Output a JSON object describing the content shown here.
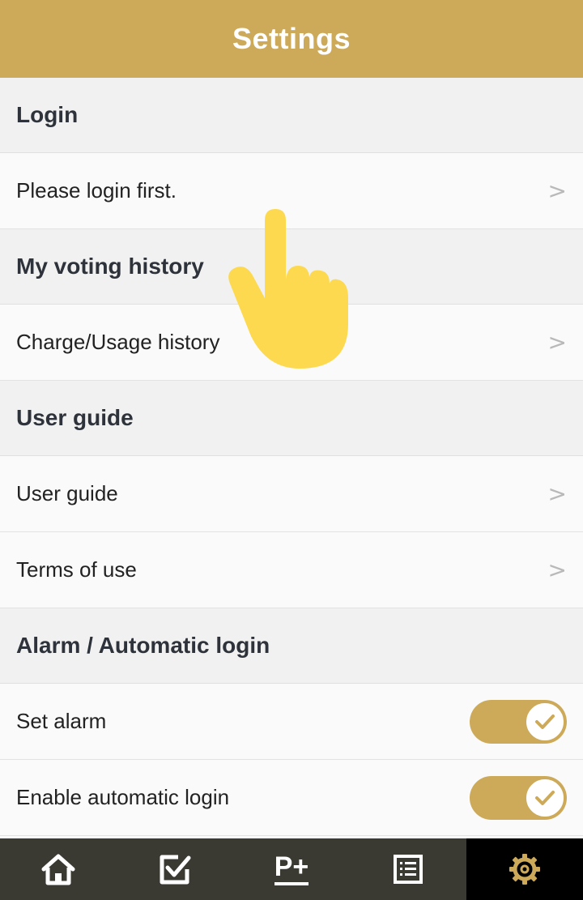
{
  "header": {
    "title": "Settings"
  },
  "sections": {
    "login": {
      "title": "Login",
      "row_label": "Please login first."
    },
    "voting": {
      "title": "My voting history",
      "row_label": "Charge/Usage history"
    },
    "guide": {
      "title": "User guide",
      "rows": [
        "User guide",
        "Terms of use"
      ]
    },
    "alarm": {
      "title": "Alarm / Automatic login",
      "rows": [
        "Set alarm",
        "Enable automatic login"
      ]
    }
  },
  "chevron": ">",
  "toggles": {
    "set_alarm": true,
    "automatic_login": true
  },
  "bottom_nav": {
    "items": [
      "home-icon",
      "vote-check-icon",
      "p-plus-icon",
      "list-icon",
      "settings-gear-icon"
    ],
    "pplus_label": "P+",
    "active": "settings-gear-icon"
  },
  "colors": {
    "accent": "#cdaa5a",
    "nav_bg": "#3a3a33",
    "nav_active_bg": "#000000",
    "section_bg": "#f1f1f1",
    "hand_overlay": "#fcd94f"
  }
}
